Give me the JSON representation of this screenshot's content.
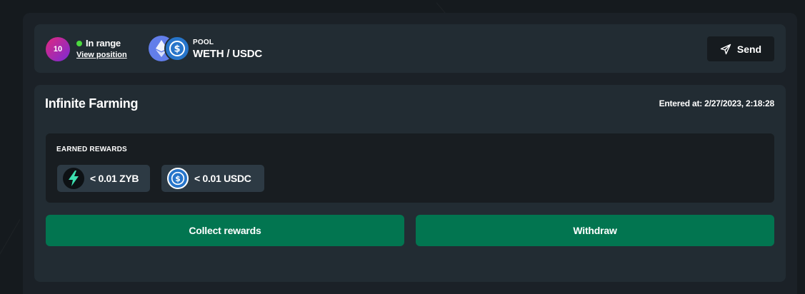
{
  "position": {
    "id": "10",
    "status": "In range",
    "view_link": "View position"
  },
  "pool": {
    "label": "POOL",
    "name": "WETH / USDC"
  },
  "send_label": "Send",
  "farming": {
    "title": "Infinite Farming",
    "entered": "Entered at: 2/27/2023, 2:18:28",
    "rewards_label": "EARNED REWARDS",
    "rewards": [
      {
        "amount": "< 0.01 ZYB",
        "icon": "zyb-icon"
      },
      {
        "amount": "< 0.01 USDC",
        "icon": "usdc-icon"
      }
    ],
    "collect_label": "Collect rewards",
    "withdraw_label": "Withdraw"
  },
  "colors": {
    "accent_green": "#027550",
    "status_green": "#4cd93f",
    "eth_blue": "#627eea",
    "usdc_blue": "#2775ca"
  }
}
